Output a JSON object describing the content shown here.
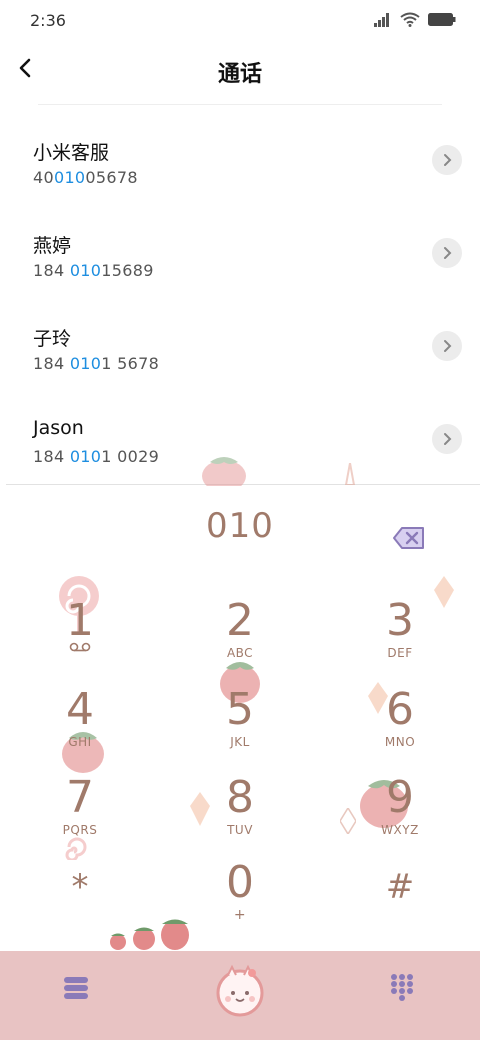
{
  "status_bar": {
    "time": "2:36"
  },
  "header": {
    "title": "通话"
  },
  "contacts": [
    {
      "name": "小米客服",
      "number_pre": "40",
      "number_match": "010",
      "number_post": "05678"
    },
    {
      "name": "燕婷",
      "number_pre": "184 ",
      "number_match": "010",
      "number_post": "15689"
    },
    {
      "name": "子玲",
      "number_pre": "184 ",
      "number_match": "010",
      "number_post": "1 5678"
    },
    {
      "name": "Jason",
      "number_pre": "184 ",
      "number_match": "010",
      "number_post": "1 0029"
    }
  ],
  "dialpad": {
    "input": "010",
    "keys": [
      {
        "digit": "1",
        "letters": ""
      },
      {
        "digit": "2",
        "letters": "ABC"
      },
      {
        "digit": "3",
        "letters": "DEF"
      },
      {
        "digit": "4",
        "letters": "GHI"
      },
      {
        "digit": "5",
        "letters": "JKL"
      },
      {
        "digit": "6",
        "letters": "MNO"
      },
      {
        "digit": "7",
        "letters": "PQRS"
      },
      {
        "digit": "8",
        "letters": "TUV"
      },
      {
        "digit": "9",
        "letters": "WXYZ"
      },
      {
        "digit": "*",
        "letters": ""
      },
      {
        "digit": "0",
        "letters": "+"
      },
      {
        "digit": "#",
        "letters": ""
      }
    ]
  },
  "icons": {
    "back": "chevron-left-icon",
    "detail": "chevron-right-icon",
    "backspace": "backspace-icon",
    "voicemail": "voicemail-icon",
    "menu": "menu-icon",
    "call": "call-icon",
    "dialpad_toggle": "dialpad-icon"
  },
  "colors": {
    "accent": "#1e8ee0",
    "dial_text": "#a07a6a",
    "bottom_bar": "#e8c3c3",
    "icon_purple": "#8a7ab8"
  }
}
